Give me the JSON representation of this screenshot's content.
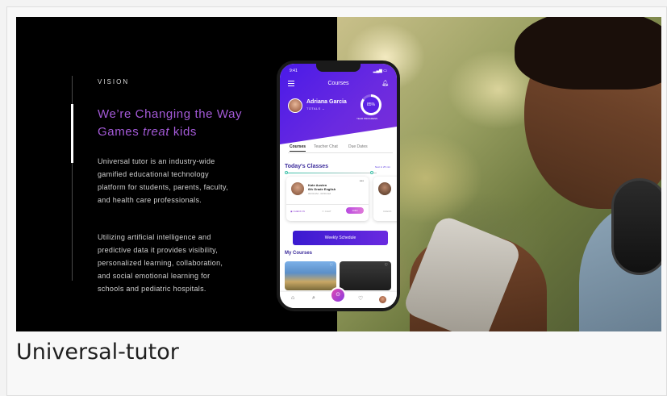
{
  "hero": {
    "eyebrow": "VISION",
    "heading_part1": "We’re Changing the Way Games ",
    "heading_em": "treat",
    "heading_part2": " kids",
    "paragraph1": "Universal tutor is an industry-wide gamified educational technology platform for students, parents, faculty, and health care professionals.",
    "paragraph2": "Utilizing artificial intelligence and predictive data it provides visibility, personalized learning, collaboration, and social emotional learning for schools and pediatric hospitals."
  },
  "app": {
    "status_time": "9:41",
    "title": "Courses",
    "profile": {
      "name": "Adriana Garcia",
      "sub": "TOTALS",
      "progress_percent": 85,
      "progress_label": "85%",
      "progress_caption": "YEAR PROGRESS"
    },
    "tabs": [
      "Courses",
      "Teacher Chat",
      "Due Dates"
    ],
    "active_tab": 0,
    "today": {
      "title": "Today's Classes",
      "timer": "Next in 25 min"
    },
    "class_card": {
      "teacher": "Kate Austen",
      "class_name": "6th Grade English",
      "time": "09:00 AM - 09:50 AM",
      "checkin": "CHECK IN",
      "chat": "CHAT",
      "join": "JOIN"
    },
    "class_card_2": {
      "checkin": "CHECK"
    },
    "schedule_button": "Weekly Schedule",
    "courses_title": "My Courses",
    "icons": [
      "menu-icon",
      "bell-icon",
      "home-icon",
      "search-icon",
      "compass-icon",
      "heart-icon"
    ]
  },
  "caption": "Universal-tutor"
}
